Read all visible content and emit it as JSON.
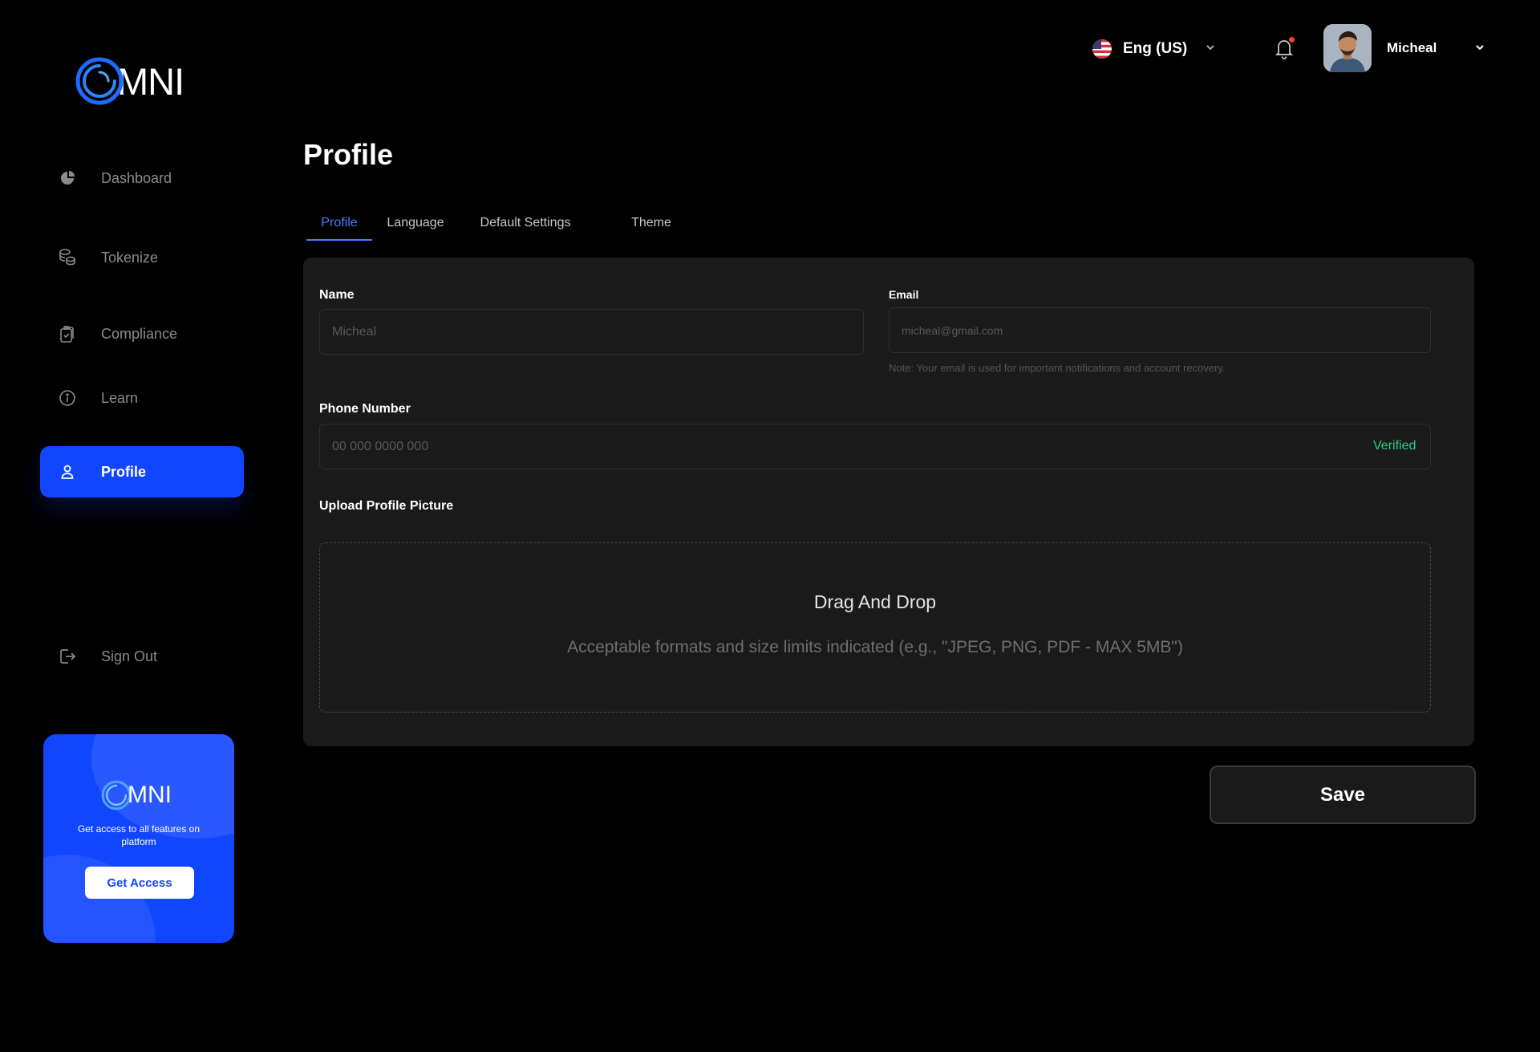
{
  "brand": {
    "logo_text": "MNI",
    "accent": "#1146ff"
  },
  "sidebar": {
    "items": [
      {
        "label": "Dashboard",
        "icon": "pie-chart-icon"
      },
      {
        "label": "Tokenize",
        "icon": "coins-icon"
      },
      {
        "label": "Compliance",
        "icon": "clipboard-icon"
      },
      {
        "label": "Learn",
        "icon": "info-circle-icon"
      },
      {
        "label": "Profile",
        "icon": "user-icon",
        "active": true
      }
    ],
    "signout_label": "Sign Out"
  },
  "promo": {
    "logo_text": "MNI",
    "text": "Get access to all features on platform",
    "button_label": "Get Access"
  },
  "header": {
    "language": "Eng (US)",
    "user_name": "Micheal",
    "has_notification": true
  },
  "page": {
    "title": "Profile",
    "tabs": [
      {
        "label": "Profile",
        "active": true
      },
      {
        "label": "Language"
      },
      {
        "label": "Default Settings"
      },
      {
        "label": "Theme"
      }
    ]
  },
  "form": {
    "name_label": "Name",
    "name_placeholder": "Micheal",
    "email_label": "Email",
    "email_placeholder": "micheal@gmail.com",
    "email_note": "Note: Your email is used for important notifications and account recovery.",
    "phone_label": "Phone Number",
    "phone_placeholder": "00 000 0000 000",
    "phone_status": "Verified",
    "upload_label": "Upload Profile Picture",
    "dropzone_title": "Drag And Drop",
    "dropzone_hint": "Acceptable formats and size limits indicated (e.g., \"JPEG, PNG, PDF - MAX 5MB\")",
    "save_label": "Save"
  }
}
